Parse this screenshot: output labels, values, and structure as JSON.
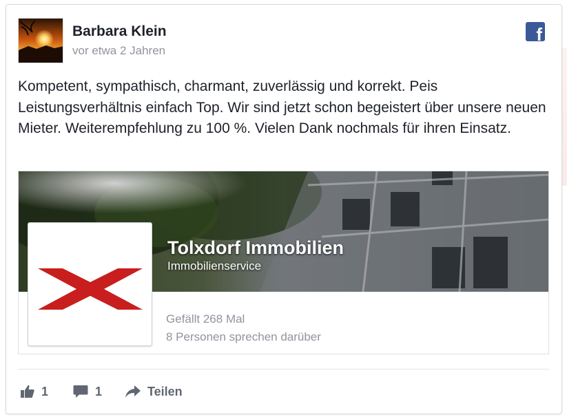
{
  "post": {
    "author": "Barbara Klein",
    "timestamp": "vor etwa 2 Jahren",
    "text": "Kompetent, sympathisch, charmant, zuverlässig und korrekt. Peis Leistungsverhältnis einfach Top. Wir sind jetzt schon begeistert über unsere neuen Mieter. Weiterempfehlung zu 100 %. Vielen Dank nochmals für ihren Einsatz."
  },
  "platform_icon": "facebook-icon",
  "page": {
    "name": "Tolxdorf Immobilien",
    "category": "Immobilienservice",
    "likes": "Gefällt 268 Mal",
    "talking": "8 Personen sprechen darüber",
    "logo_color": "#cc1f1f"
  },
  "actions": {
    "like_count": "1",
    "comment_count": "1",
    "share_label": "Teilen"
  },
  "colors": {
    "facebook_blue": "#3b5998",
    "muted_text": "#90949c",
    "action_text": "#606770"
  }
}
